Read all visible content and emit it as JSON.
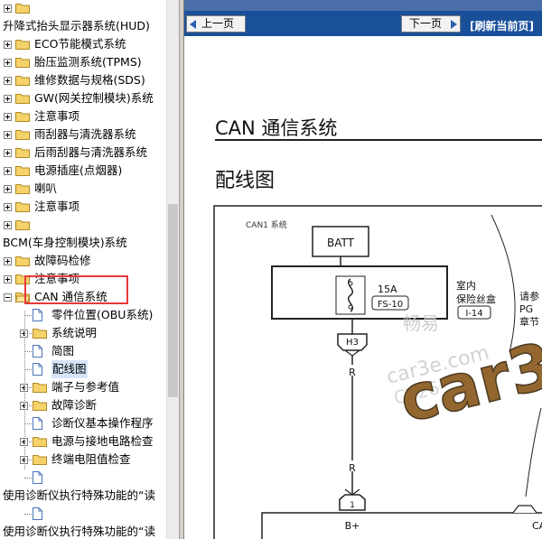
{
  "tree": {
    "rows": [
      {
        "depth": 1,
        "exp": "plus",
        "icon": "folder",
        "label": ""
      },
      {
        "depth": 0,
        "exp": "",
        "icon": "",
        "label": "升降式抬头显示器系统(HUD)"
      },
      {
        "depth": 1,
        "exp": "plus",
        "icon": "folder",
        "label": "ECO节能模式系统"
      },
      {
        "depth": 1,
        "exp": "plus",
        "icon": "folder",
        "label": "胎压监测系统(TPMS)"
      },
      {
        "depth": 1,
        "exp": "plus",
        "icon": "folder",
        "label": "维修数据与规格(SDS)"
      },
      {
        "depth": 1,
        "exp": "plus",
        "icon": "folder",
        "label": "GW(网关控制模块)系统"
      },
      {
        "depth": 1,
        "exp": "plus",
        "icon": "folder",
        "label": "注意事项"
      },
      {
        "depth": 1,
        "exp": "plus",
        "icon": "folder",
        "label": "雨刮器与清洗器系统"
      },
      {
        "depth": 1,
        "exp": "plus",
        "icon": "folder",
        "label": "后雨刮器与清洗器系统"
      },
      {
        "depth": 1,
        "exp": "plus",
        "icon": "folder",
        "label": "电源插座(点烟器)"
      },
      {
        "depth": 1,
        "exp": "plus",
        "icon": "folder",
        "label": "喇叭"
      },
      {
        "depth": 1,
        "exp": "plus",
        "icon": "folder",
        "label": "注意事项"
      },
      {
        "depth": 1,
        "exp": "plus",
        "icon": "folder",
        "label": ""
      },
      {
        "depth": 0,
        "exp": "",
        "icon": "",
        "label": "BCM(车身控制模块)系统"
      },
      {
        "depth": 1,
        "exp": "plus",
        "icon": "folder",
        "label": "故障码检修"
      },
      {
        "depth": 1,
        "exp": "plus",
        "icon": "folder",
        "label": "注意事项"
      },
      {
        "depth": 1,
        "exp": "minus",
        "icon": "folder-open",
        "label": "CAN 通信系统"
      },
      {
        "depth": 2,
        "exp": "",
        "icon": "page",
        "label": "零件位置(OBU系统)"
      },
      {
        "depth": 2,
        "exp": "plus",
        "icon": "folder",
        "label": "系统说明"
      },
      {
        "depth": 2,
        "exp": "",
        "icon": "page",
        "label": "简图"
      },
      {
        "depth": 2,
        "exp": "",
        "icon": "page",
        "label": "配线图",
        "selected": true
      },
      {
        "depth": 2,
        "exp": "plus",
        "icon": "folder",
        "label": "端子与参考值"
      },
      {
        "depth": 2,
        "exp": "plus",
        "icon": "folder",
        "label": "故障诊断"
      },
      {
        "depth": 2,
        "exp": "",
        "icon": "page",
        "label": "诊断仪基本操作程序"
      },
      {
        "depth": 2,
        "exp": "plus",
        "icon": "folder",
        "label": "电源与接地电路检查"
      },
      {
        "depth": 2,
        "exp": "plus",
        "icon": "folder",
        "label": "终端电阻值检查"
      },
      {
        "depth": 2,
        "exp": "",
        "icon": "page",
        "label": ""
      },
      {
        "depth": 0,
        "exp": "",
        "icon": "",
        "label": "使用诊断仪执行特殊功能的“读"
      },
      {
        "depth": 2,
        "exp": "",
        "icon": "page",
        "label": ""
      },
      {
        "depth": 0,
        "exp": "",
        "icon": "",
        "label": "使用诊断仪执行特殊功能的“读"
      },
      {
        "depth": 2,
        "exp": "",
        "icon": "page",
        "label": ""
      }
    ]
  },
  "toolbar": {
    "prev_label": "上一页",
    "next_label": "下一页",
    "refresh_label": "[刷新当前页]"
  },
  "document": {
    "title": "CAN 通信系统",
    "subtitle": "配线图",
    "diagram": {
      "header": "CAN1 系统",
      "batt": "BATT",
      "fuse_amp": "15A",
      "fuse_id": "FS-10",
      "fuse_box_label1": "室内",
      "fuse_box_label2": "保险丝盒",
      "fuse_box_conn": "I-14",
      "side_label1": "请参",
      "side_label2": "PG",
      "side_label3": "章节",
      "connector": "H3",
      "wire_color_1": "R",
      "wire_color_2": "R",
      "pin": "1",
      "terminal": "B+",
      "terminal_right": "CA"
    },
    "watermark": {
      "brand": "car3",
      "cn": "畅易",
      "site": "car3e.com",
      "sub": "CY26"
    }
  },
  "colors": {
    "toolbar_bg": "#1a4f9a",
    "highlight_box": "#e8373a",
    "folder_yellow": "#f5d36a"
  }
}
